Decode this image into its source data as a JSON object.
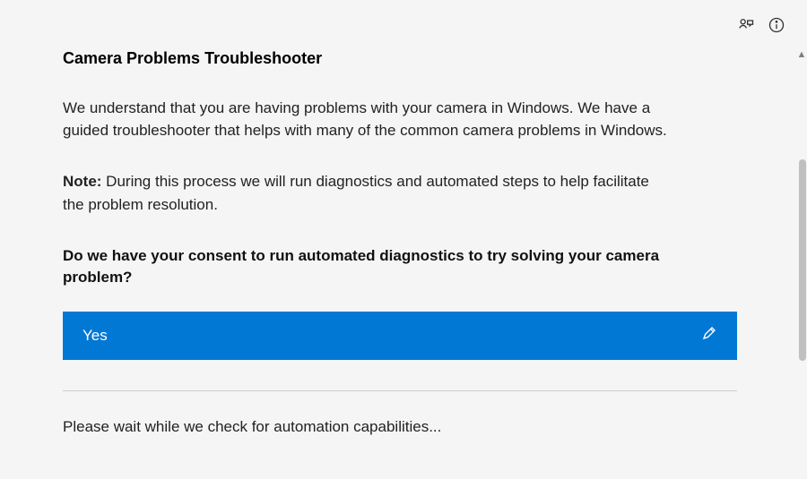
{
  "header": {
    "feedback_icon": "feedback-icon",
    "info_icon": "info-icon"
  },
  "main": {
    "title": "Camera Problems Troubleshooter",
    "intro": "We understand that you are having problems with your camera in Windows. We have a guided troubleshooter that helps with many of the common camera problems in Windows.",
    "note_label": "Note:",
    "note_text": " During this process we will run diagnostics and automated steps to help facilitate the problem resolution.",
    "consent_question": "Do we have your consent to run automated diagnostics to try solving your camera problem?",
    "yes_label": "Yes",
    "waiting_text": "Please wait while we check for automation capabilities..."
  },
  "colors": {
    "primary": "#0078d4"
  }
}
